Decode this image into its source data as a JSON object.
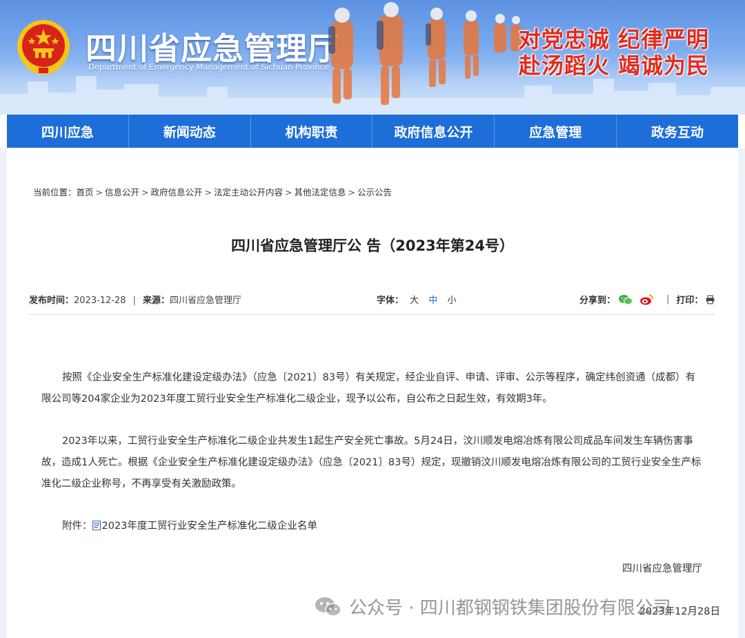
{
  "header": {
    "site_title": "四川省应急管理厅",
    "site_subtitle": "Department of Emergency Management of Sichuan Province",
    "slogan_line1": "对党忠诚  纪律严明",
    "slogan_line2": "赴汤蹈火  竭诚为民",
    "slogan_color": "#e22a1c"
  },
  "nav": {
    "items": [
      "四川应急",
      "新闻动态",
      "机构职责",
      "政府信息公开",
      "应急管理",
      "政务互动"
    ],
    "color": "#1d6ed8"
  },
  "breadcrumb": {
    "prefix": "当前位置：",
    "items": [
      "首页",
      "信息公开",
      "政府信息公开",
      "法定主动公开内容",
      "其他法定信息",
      "公示公告"
    ],
    "separator": ">"
  },
  "article": {
    "title": "四川省应急管理厅公 告（2023年第24号）",
    "publish_label": "发布时间：",
    "publish_date": "2023-12-28",
    "source_label": "来源：",
    "source": "四川省应急管理厅",
    "font_label": "字体：",
    "font_sizes": [
      "大",
      "中",
      "小"
    ],
    "font_active": "中",
    "share_label": "分享到：",
    "share_icons": [
      "wechat-icon",
      "weibo-icon"
    ],
    "print_label": "打印：",
    "print_icon": "printer-icon",
    "paragraph1": "按照《企业安全生产标准化建设定级办法》（应急〔2021〕83号）有关规定，经企业自评、申请、评审、公示等程序，确定纬创资通（成都）有限公司等204家企业为2023年度工贸行业安全生产标准化二级企业，现予以公布，自公布之日起生效，有效期3年。",
    "paragraph2": "2023年以来，工贸行业安全生产标准化二级企业共发生1起生产安全死亡事故。5月24日，汶川顺发电熔冶炼有限公司成品车间发生车辆伤害事故，造成1人死亡。根据《企业安全生产标准化建设定级办法》（应急〔2021〕83号）规定，现撤销汶川顺发电熔冶炼有限公司的工贸行业安全生产标准化二级企业称号，不再享受有关激励政策。",
    "attachment_label": "附件：",
    "attachment_name": "2023年度工贸行业安全生产标准化二级企业名单",
    "signature": "四川省应急管理厅",
    "sign_date": "2023年12月28日"
  },
  "watermark": {
    "text": "公众号 · 四川都钢钢铁集团股份有限公司"
  }
}
